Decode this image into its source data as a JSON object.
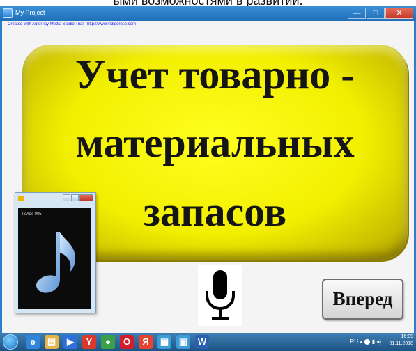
{
  "page_caption": "ыми возможностями в развитии.",
  "window": {
    "title": "My Project",
    "controls": [
      "—",
      "□",
      "✕"
    ]
  },
  "app": {
    "credit_line": "Created with AutoPlay Media Studio Trial - http://www.indigorose.com",
    "banner_lines": [
      "Учет товарно -",
      "материальных",
      "запасов"
    ],
    "next_button_label": "Вперед"
  },
  "media_player": {
    "label": "Голос 005",
    "icon": "music-note-icon"
  },
  "microphone": {
    "icon": "microphone-icon"
  },
  "taskbar": {
    "apps": [
      {
        "name": "internet-explorer",
        "glyph": "e",
        "color": "#2f86d8"
      },
      {
        "name": "file-explorer",
        "glyph": "▤",
        "color": "#e5b443"
      },
      {
        "name": "media-player",
        "glyph": "▶",
        "color": "#2f6fd8"
      },
      {
        "name": "yandex-browser",
        "glyph": "Y",
        "color": "#d93a2b"
      },
      {
        "name": "chrome",
        "glyph": "●",
        "color": "#3aa14a"
      },
      {
        "name": "opera",
        "glyph": "O",
        "color": "#d21e2b"
      },
      {
        "name": "yandex",
        "glyph": "Я",
        "color": "#e8432f"
      },
      {
        "name": "autoplay-app",
        "glyph": "▣",
        "color": "#3b9cd6"
      },
      {
        "name": "autoplay-app-2",
        "glyph": "▣",
        "color": "#3b9cd6"
      },
      {
        "name": "word",
        "glyph": "W",
        "color": "#2b5fb0"
      }
    ],
    "language": "RU",
    "time": "16:09",
    "date": "01.11.2018"
  },
  "colors": {
    "banner_yellow": "#f2ef00",
    "titlebar_blue": "#1f6fb8",
    "close_red": "#c33a2a"
  }
}
